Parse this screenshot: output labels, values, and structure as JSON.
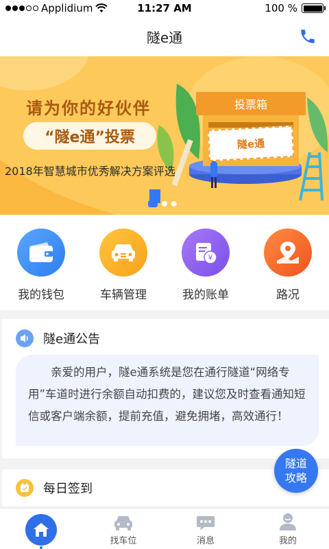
{
  "status_bar": {
    "carrier": "Applidium",
    "time": "11:27 AM",
    "battery": "100 %",
    "signal_bars_filled": 3,
    "signal_bars_total": 5,
    "battery_level": 1.0
  },
  "nav": {
    "title": "隧e通",
    "phone_icon": "phone-icon"
  },
  "banner": {
    "title": "请为你的好伙伴",
    "pill": "“隧e通”投票",
    "subtitle": "2018年智慧城市优秀解决方案评选",
    "ballot_label": "投票箱",
    "ballot_card": "隧e通",
    "page_count": 3,
    "active_page": 1
  },
  "quick_menu": [
    {
      "label": "我的钱包",
      "icon": "wallet-icon",
      "color": "#3b8ef5"
    },
    {
      "label": "车辆管理",
      "icon": "car-icon",
      "color": "#fbab1c"
    },
    {
      "label": "我的账单",
      "icon": "bill-icon",
      "color": "#8e5cf2"
    },
    {
      "label": "路况",
      "icon": "map-pin-icon",
      "color": "#f46a2a"
    }
  ],
  "notice": {
    "title": "隧e通公告",
    "icon": "speaker-icon",
    "body": "亲爱的用户，隧e通系统是您在通行隧道“网络专用”车道时进行余额自动扣费的，建议您及时查看通知短信或客户端余额，提前充值，避免拥堵，高效通行！"
  },
  "daily": {
    "title": "每日签到",
    "icon": "calendar-icon"
  },
  "fab": {
    "line1": "隧道",
    "line2": "攻略"
  },
  "tabs": [
    {
      "label": "",
      "icon": "home-icon",
      "active": true
    },
    {
      "label": "找车位",
      "icon": "car-icon",
      "active": false
    },
    {
      "label": "消息",
      "icon": "chat-icon",
      "active": false
    },
    {
      "label": "我的",
      "icon": "user-icon",
      "active": false
    }
  ],
  "colors": {
    "accent": "#2f6fe8",
    "banner_bg": "#fdc95a",
    "banner_text": "#a85a10"
  }
}
